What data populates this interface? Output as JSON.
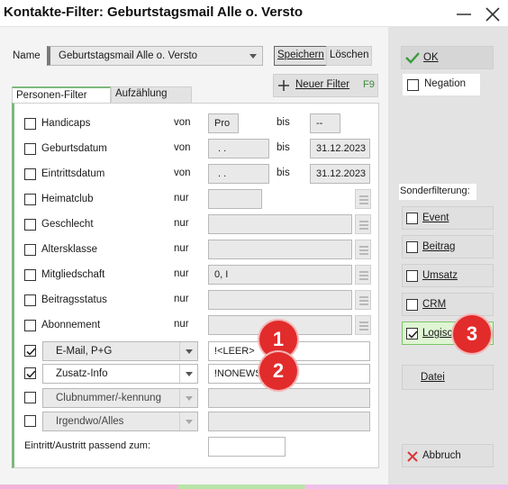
{
  "window": {
    "title": "Kontakte-Filter: Geburtstagsmail Alle o. Versto"
  },
  "name_row": {
    "label": "Name",
    "value": "Geburtstagsmail Alle o. Versto",
    "save_label": "Speichern",
    "delete_label": "Löschen"
  },
  "new_filter": {
    "label": "Neuer Filter",
    "shortcut": "F9"
  },
  "tabs": [
    {
      "label": "Personen-Filter"
    },
    {
      "label": "Aufzählung"
    }
  ],
  "filters": [
    {
      "label": "Handicaps",
      "op": "von",
      "value": "Pro",
      "bis": "bis",
      "value2": "--"
    },
    {
      "label": "Geburtsdatum",
      "op": "von",
      "value": ". .",
      "bis": "bis",
      "value2": "31.12.2023"
    },
    {
      "label": "Eintrittsdatum",
      "op": "von",
      "value": ". .",
      "bis": "bis",
      "value2": "31.12.2023"
    },
    {
      "label": "Heimatclub",
      "op": "nur",
      "value": ""
    },
    {
      "label": "Geschlecht",
      "op": "nur",
      "value": ""
    },
    {
      "label": "Altersklasse",
      "op": "nur",
      "value": ""
    },
    {
      "label": "Mitgliedschaft",
      "op": "nur",
      "value": "0, I"
    },
    {
      "label": "Beitragsstatus",
      "op": "nur",
      "value": ""
    },
    {
      "label": "Abonnement",
      "op": "nur",
      "value": ""
    }
  ],
  "custom_filters": [
    {
      "field": "E-Mail, P+G",
      "value": "!<LEER>",
      "checked": true
    },
    {
      "field": "Zusatz-Info",
      "value": "!NONEWS",
      "checked": true
    },
    {
      "field": "Clubnummer/-kennung",
      "value": "",
      "checked": false
    },
    {
      "field": "Irgendwo/Alles",
      "value": "",
      "checked": false
    }
  ],
  "entry_exit": {
    "label": "Eintritt/Austritt passend zum:",
    "value": ""
  },
  "right": {
    "ok_label": "OK",
    "negation_label": "Negation",
    "special_heading": "Sonderfilterung:",
    "special": [
      {
        "label": "Event",
        "checked": false
      },
      {
        "label": "Beitrag",
        "checked": false
      },
      {
        "label": "Umsatz",
        "checked": false
      },
      {
        "label": "CRM",
        "checked": false
      },
      {
        "label": "Logisch",
        "checked": true
      }
    ],
    "file_label": "Datei",
    "cancel_label": "Abbruch"
  },
  "badges": [
    "1",
    "2",
    "3"
  ],
  "colors": {
    "accent_green": "#7cb87c",
    "badge_red": "#e22b2b",
    "ok_check": "#3a9a3a",
    "cancel_x": "#d93636"
  }
}
